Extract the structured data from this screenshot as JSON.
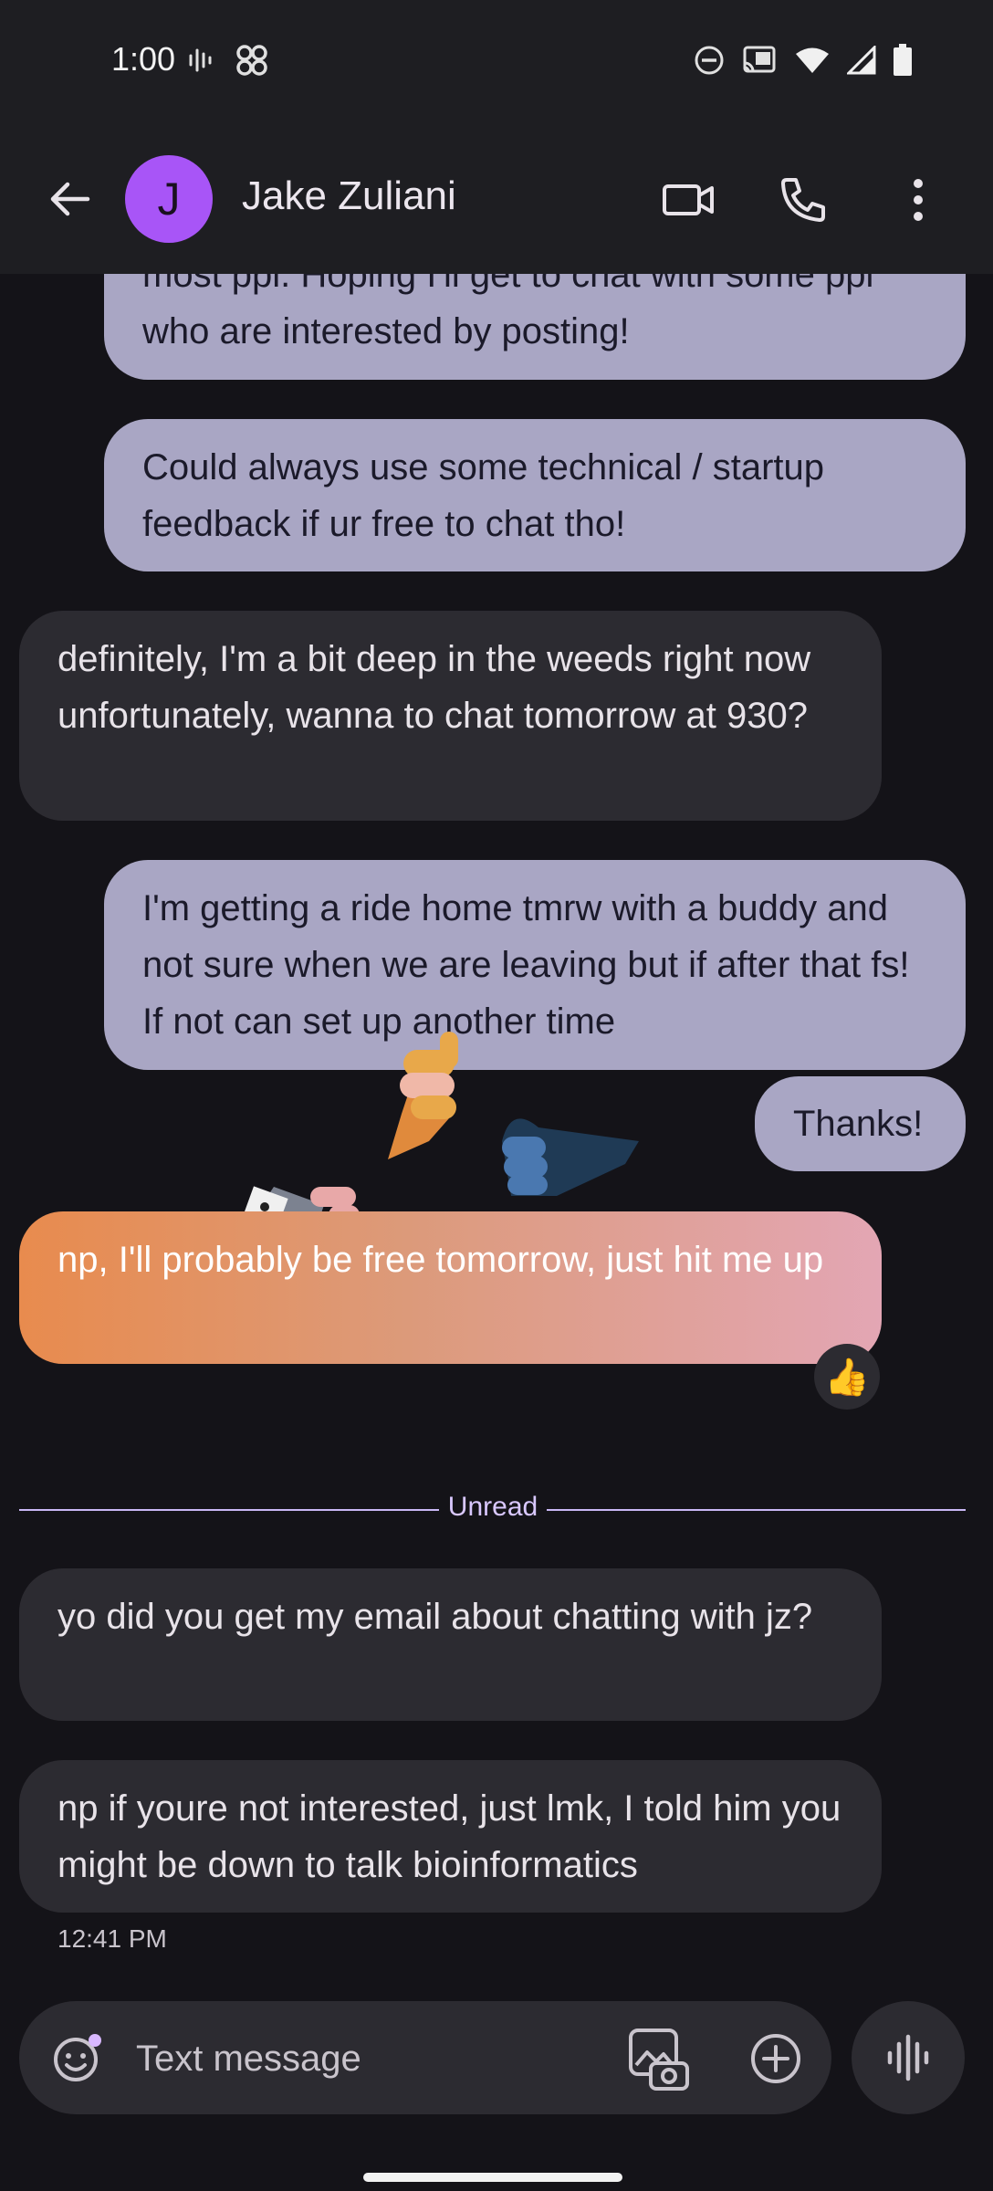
{
  "status_bar": {
    "time": "1:00"
  },
  "header": {
    "avatar_initial": "J",
    "contact_name": "Jake Zuliani"
  },
  "messages": [
    {
      "from": "me",
      "text": "most ppl. Hoping I'll get to chat with some ppl who are interested by posting!"
    },
    {
      "from": "me",
      "text": "Could always use some technical / startup feedback if ur free to chat tho!"
    },
    {
      "from": "them",
      "text": "definitely, I'm a bit deep in the weeds right now unfortunately, wanna to chat tomorrow at 930?"
    },
    {
      "from": "me",
      "text": "I'm getting a ride home tmrw with a buddy and not sure when we are leaving but if after that fs! If not can set up another time"
    },
    {
      "from": "me",
      "text": "Thanks!"
    },
    {
      "from": "them",
      "text": "np, I'll probably be free tomorrow, just hit me up",
      "reaction": "👍"
    },
    {
      "from": "them",
      "text": "yo did you get my email about chatting with jz?"
    },
    {
      "from": "them",
      "text": "np if youre not interested, just lmk, I told him you might be down to talk bioinformatics"
    }
  ],
  "divider": {
    "label": "Unread"
  },
  "last_timestamp": "12:41 PM",
  "composer": {
    "placeholder": "Text message"
  },
  "colors": {
    "outgoing_bubble": "#a9a6c4",
    "incoming_bubble": "#2c2b31",
    "accent": "#a855f7",
    "background": "#141318"
  }
}
